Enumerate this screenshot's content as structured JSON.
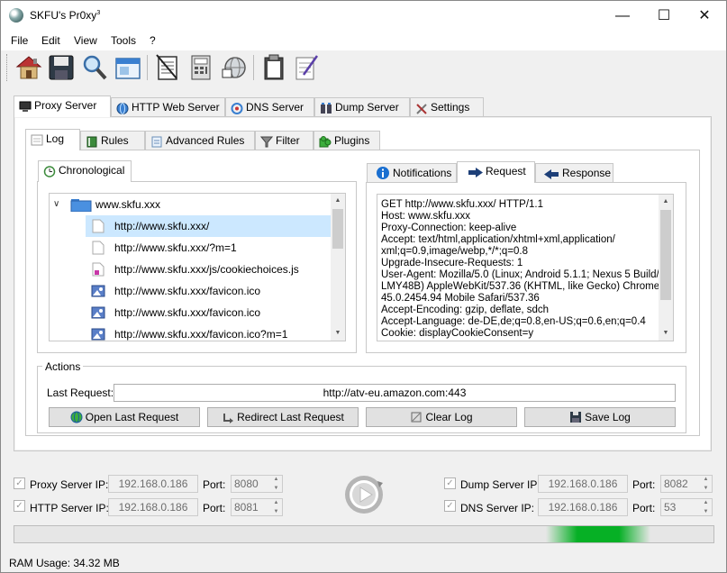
{
  "window": {
    "title": "SKFU's Pr0xy",
    "title_sup": "3",
    "controls": {
      "minimize": "—",
      "maximize": "☐",
      "close": "✕"
    }
  },
  "menu": [
    "File",
    "Edit",
    "View",
    "Tools",
    "?"
  ],
  "toolbar_icons": [
    "home-icon",
    "save-icon",
    "search-icon",
    "window-icon",
    "notepad-icon",
    "calculator-icon",
    "network-icon",
    "clipboard-icon",
    "checklist-icon"
  ],
  "main_tabs": [
    {
      "label": "Proxy Server",
      "icon": "monitor-icon",
      "active": true
    },
    {
      "label": "HTTP Web Server",
      "icon": "globe-icon"
    },
    {
      "label": "DNS Server",
      "icon": "dns-icon"
    },
    {
      "label": "Dump Server",
      "icon": "servers-icon"
    },
    {
      "label": "Settings",
      "icon": "tools-icon"
    }
  ],
  "sub_tabs": [
    {
      "label": "Log",
      "icon": "log-icon",
      "active": true
    },
    {
      "label": "Rules",
      "icon": "book-icon"
    },
    {
      "label": "Advanced Rules",
      "icon": "document-icon"
    },
    {
      "label": "Filter",
      "icon": "funnel-icon"
    },
    {
      "label": "Plugins",
      "icon": "puzzle-icon"
    }
  ],
  "tree": {
    "tab_label": "Chronological",
    "root": "www.skfu.xxx",
    "items": [
      {
        "label": "http://www.skfu.xxx/",
        "icon": "blank-page-icon",
        "selected": true
      },
      {
        "label": "http://www.skfu.xxx/?m=1",
        "icon": "blank-page-icon"
      },
      {
        "label": "http://www.skfu.xxx/js/cookiechoices.js",
        "icon": "script-page-icon"
      },
      {
        "label": "http://www.skfu.xxx/favicon.ico",
        "icon": "image-icon"
      },
      {
        "label": "http://www.skfu.xxx/favicon.ico",
        "icon": "image-icon"
      },
      {
        "label": "http://www.skfu.xxx/favicon.ico?m=1",
        "icon": "image-icon"
      }
    ]
  },
  "detail_tabs": [
    {
      "label": "Notifications",
      "icon": "info-icon"
    },
    {
      "label": "Request",
      "icon": "arrow-right-icon",
      "active": true
    },
    {
      "label": "Response",
      "icon": "arrow-left-icon"
    }
  ],
  "request_lines": [
    "GET http://www.skfu.xxx/ HTTP/1.1",
    "Host: www.skfu.xxx",
    "Proxy-Connection: keep-alive",
    "Accept: text/html,application/xhtml+xml,application/",
    "xml;q=0.9,image/webp,*/*;q=0.8",
    "Upgrade-Insecure-Requests: 1",
    "User-Agent: Mozilla/5.0 (Linux; Android 5.1.1; Nexus 5 Build/",
    "LMY48B) AppleWebKit/537.36 (KHTML, like Gecko) Chrome/",
    "45.0.2454.94 Mobile Safari/537.36",
    "Accept-Encoding: gzip, deflate, sdch",
    "Accept-Language: de-DE,de;q=0.8,en-US;q=0.6,en;q=0.4",
    "Cookie: displayCookieConsent=y"
  ],
  "actions": {
    "title": "Actions",
    "last_request_label": "Last Request:",
    "last_request_value": "http://atv-eu.amazon.com:443",
    "buttons": [
      {
        "label": "Open Last Request",
        "icon": "globe-icon"
      },
      {
        "label": "Redirect Last Request",
        "icon": "redirect-icon"
      },
      {
        "label": "Clear Log",
        "icon": "broom-icon"
      },
      {
        "label": "Save Log",
        "icon": "floppy-icon"
      }
    ]
  },
  "servers": {
    "left": [
      {
        "label": "Proxy Server IP:",
        "ip": "192.168.0.186",
        "port_label": "Port:",
        "port": "8080",
        "checked": true
      },
      {
        "label": "HTTP Server IP:",
        "ip": "192.168.0.186",
        "port_label": "Port:",
        "port": "8081",
        "checked": true
      }
    ],
    "right": [
      {
        "label": "Dump Server IP:",
        "ip": "192.168.0.186",
        "port_label": "Port:",
        "port": "8082",
        "checked": true
      },
      {
        "label": "DNS Server IP:",
        "ip": "192.168.0.186",
        "port_label": "Port:",
        "port": "53",
        "checked": true
      }
    ]
  },
  "progress": {
    "activity_fraction": 0.15
  },
  "status": {
    "ram_usage": "RAM Usage: 34.32 MB"
  },
  "colors": {
    "selection": "#cce8ff",
    "progress": "#06b025",
    "accent": "#0078d7"
  }
}
